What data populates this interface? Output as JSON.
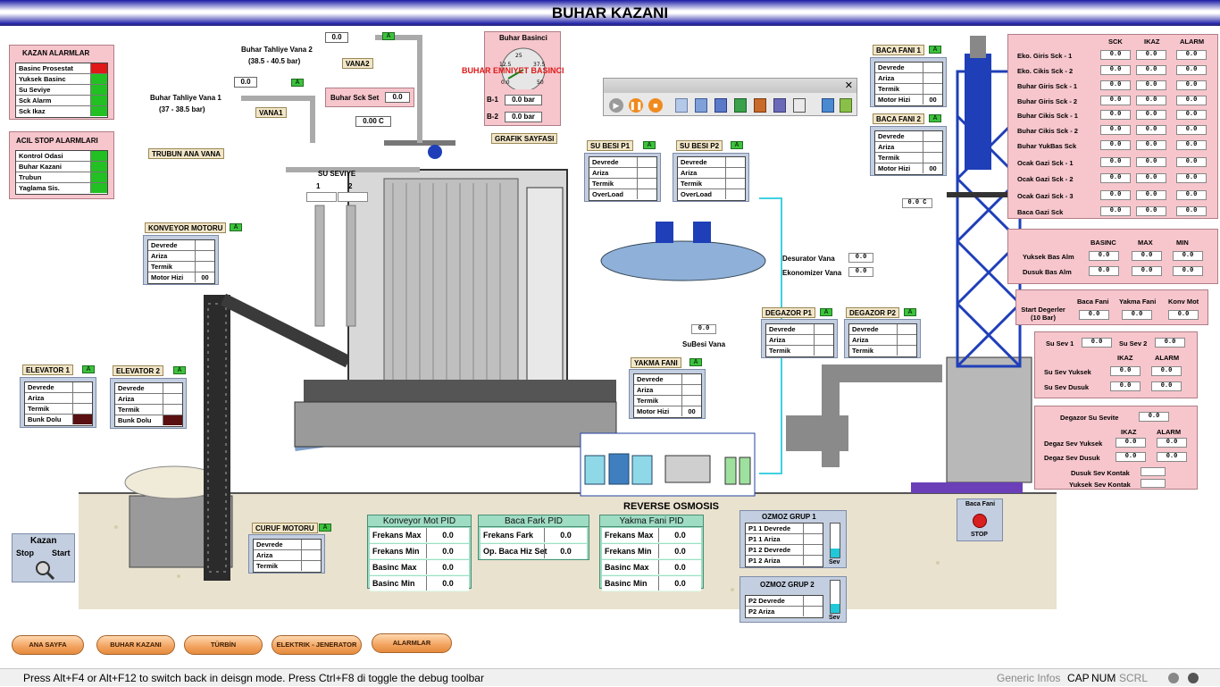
{
  "title": "BUHAR KAZANI",
  "kazan_alarmlar": {
    "title": "KAZAN ALARMLAR",
    "items": [
      {
        "label": "Basinc Prosestat",
        "color": "#e01818"
      },
      {
        "label": "Yuksek Basinc",
        "color": "#22c022"
      },
      {
        "label": "Su Seviye",
        "color": "#22c022"
      },
      {
        "label": "Sck Alarm",
        "color": "#22c022"
      },
      {
        "label": "Sck Ikaz",
        "color": "#22c022"
      }
    ]
  },
  "acil_stop": {
    "title": "ACIL STOP ALARMLARI",
    "items": [
      {
        "label": "Kontrol Odasi",
        "color": "#22c022"
      },
      {
        "label": "Buhar Kazani",
        "color": "#22c022"
      },
      {
        "label": "Trubun",
        "color": "#22c022"
      },
      {
        "label": "Yaglama Sis.",
        "color": "#22c022"
      }
    ]
  },
  "valves": {
    "vana2_label": "Buhar Tahliye Vana 2",
    "vana2_range": "(38.5 - 40.5 bar)",
    "vana2_tag": "VANA2",
    "vana2_val": "0.0",
    "vana1_label": "Buhar Tahliye Vana 1",
    "vana1_range": "(37 - 38.5 bar)",
    "vana1_tag": "VANA1",
    "vana1_val": "0.0",
    "turbin_tag": "TRUBUN ANA VANA",
    "sck_set_label": "Buhar Sck Set",
    "sck_set_val": "0.0",
    "temp_val": "0.00 C",
    "a_label": "A"
  },
  "buhar_basinci": {
    "title": "Buhar Basinci",
    "overlay": "BUHAR EMNIYET BASINCI",
    "gauge_ticks": [
      "12.5",
      "25",
      "37.5",
      "0.0",
      "50"
    ],
    "b1_label": "B-1",
    "b1_val": "0.0 bar",
    "b2_label": "B-2",
    "b2_val": "0.0 bar",
    "grafik": "GRAFIK SAYFASI"
  },
  "su_seviye": {
    "title": "SU SEVIYE",
    "n1": "1",
    "n2": "2"
  },
  "konveyor_motoru": {
    "tag": "KONVEYOR MOTORU",
    "rows": [
      "Devrede",
      "Ariza",
      "Termik",
      "Motor Hizi"
    ],
    "motor_val": "00"
  },
  "elevator1": {
    "tag": "ELEVATOR 1",
    "rows": [
      "Devrede",
      "Ariza",
      "Termik",
      "Bunk Dolu"
    ]
  },
  "elevator2": {
    "tag": "ELEVATOR 2",
    "rows": [
      "Devrede",
      "Ariza",
      "Termik",
      "Bunk Dolu"
    ]
  },
  "su_besi_p1": {
    "tag": "SU BESI P1",
    "rows": [
      "Devrede",
      "Ariza",
      "Termik",
      "OverLoad"
    ]
  },
  "su_besi_p2": {
    "tag": "SU BESI P2",
    "rows": [
      "Devrede",
      "Ariza",
      "Termik",
      "OverLoad"
    ]
  },
  "yakma_fani": {
    "tag": "YAKMA FANI",
    "rows": [
      "Devrede",
      "Ariza",
      "Termik",
      "Motor Hizi"
    ],
    "motor_val": "00"
  },
  "degazor_p1": {
    "tag": "DEGAZOR P1",
    "rows": [
      "Devrede",
      "Ariza",
      "Termik"
    ]
  },
  "degazor_p2": {
    "tag": "DEGAZOR P2",
    "rows": [
      "Devrede",
      "Ariza",
      "Termik"
    ]
  },
  "baca_fani1": {
    "tag": "BACA FANI 1",
    "rows": [
      "Devrede",
      "Ariza",
      "Termik",
      "Motor Hizi"
    ],
    "motor_val": "00"
  },
  "baca_fani2": {
    "tag": "BACA FANI 2",
    "rows": [
      "Devrede",
      "Ariza",
      "Termik",
      "Motor Hizi"
    ],
    "motor_val": "00"
  },
  "curuf_motoru": {
    "tag": "CURUF MOTORU",
    "rows": [
      "Devrede",
      "Ariza",
      "Termik"
    ]
  },
  "desurator": {
    "desurator_label": "Desurator Vana",
    "desurator_val": "0.0",
    "ekonomizer_label": "Ekonomizer Vana",
    "ekonomizer_val": "0.0",
    "subesi_label": "SuBesi Vana",
    "subesi_val": "0.0",
    "baca_temp": "0.0 C"
  },
  "sck_table": {
    "headers": [
      "SCK",
      "IKAZ",
      "ALARM"
    ],
    "rows": [
      "Eko. Giris Sck - 1",
      "Eko. Cikis Sck - 2",
      "Buhar Giris Sck - 1",
      "Buhar Giris Sck - 2",
      "Buhar Cikis Sck - 1",
      "Buhar Cikis Sck - 2",
      "Buhar YukBas Sck",
      "Ocak Gazi Sck - 1",
      "Ocak Gazi Sck - 2",
      "Ocak Gazi Sck - 3",
      "Baca Gazi Sck"
    ],
    "cell": "0.0"
  },
  "basinc_table": {
    "headers": [
      "BASINC",
      "MAX",
      "MIN"
    ],
    "rows": [
      "Yuksek Bas Alm",
      "Dusuk Bas Alm"
    ],
    "cell": "0.0"
  },
  "start_deger": {
    "label": "Start Degerler (10 Bar)",
    "headers": [
      "Baca Fani",
      "Yakma Fani",
      "Konv Mot"
    ],
    "cell": "0.0"
  },
  "su_sev": {
    "sev1": "Su Sev 1",
    "sev2": "Su Sev 2",
    "headers": [
      "IKAZ",
      "ALARM"
    ],
    "rows": [
      "Su Sev Yuksek",
      "Su Sev Dusuk"
    ],
    "cell": "0.0"
  },
  "degazor_sev": {
    "title": "Degazor Su Sevite",
    "headers": [
      "IKAZ",
      "ALARM"
    ],
    "rows": [
      "Degaz Sev Yuksek",
      "Degaz Sev Dusuk"
    ],
    "kontak": [
      "Dusuk Sev Kontak",
      "Yuksek Sev Kontak"
    ],
    "cell": "0.0"
  },
  "reverse_osmosis": "REVERSE OSMOSIS",
  "pid": [
    {
      "title": "Konveyor Mot PID",
      "rows": [
        "Frekans Max",
        "Frekans Min",
        "Basinc Max",
        "Basinc Min"
      ],
      "val": "0.0"
    },
    {
      "title": "Baca Fark PID",
      "rows": [
        "Frekans Fark",
        "Op. Baca Hiz Set"
      ],
      "val": "0.0"
    },
    {
      "title": "Yakma Fani PID",
      "rows": [
        "Frekans Max",
        "Frekans Min",
        "Basinc Max",
        "Basinc Min"
      ],
      "val": "0.0"
    }
  ],
  "ozmoz1": {
    "title": "OZMOZ GRUP 1",
    "rows": [
      "P1 1 Devrede",
      "P1 1 Ariza",
      "P1 2 Devrede",
      "P1 2 Ariza"
    ],
    "sev": "Sev"
  },
  "ozmoz2": {
    "title": "OZMOZ GRUP 2",
    "rows": [
      "P2 Devrede",
      "P2 Ariza"
    ],
    "sev": "Sev"
  },
  "baca_fani_stop": {
    "title": "Baca Fani",
    "stop": "STOP"
  },
  "kazan_ctrl": {
    "title": "Kazan",
    "stop": "Stop",
    "start": "Start"
  },
  "nav": [
    "ANA SAYFA",
    "BUHAR KAZANI",
    "TÜRBİN",
    "ELEKTRIK - JENERATOR",
    "ALARMLAR"
  ],
  "status_text": "Press Alt+F4 or Alt+F12 to switch back in deisgn mode. Press Ctrl+F8 di toggle the debug toolbar",
  "status_right": [
    "Generic Infos",
    "CAP",
    "NUM",
    "SCRL"
  ],
  "colors": {
    "title_bar": "#1c1ca6",
    "panel_pink": "#f6c6cc",
    "panel_blue": "#c3cee0",
    "panel_green": "#9fdcc4",
    "alarm_red": "#e01818",
    "ok_green": "#22c022",
    "boiler_blue": "#1f3fb8"
  }
}
